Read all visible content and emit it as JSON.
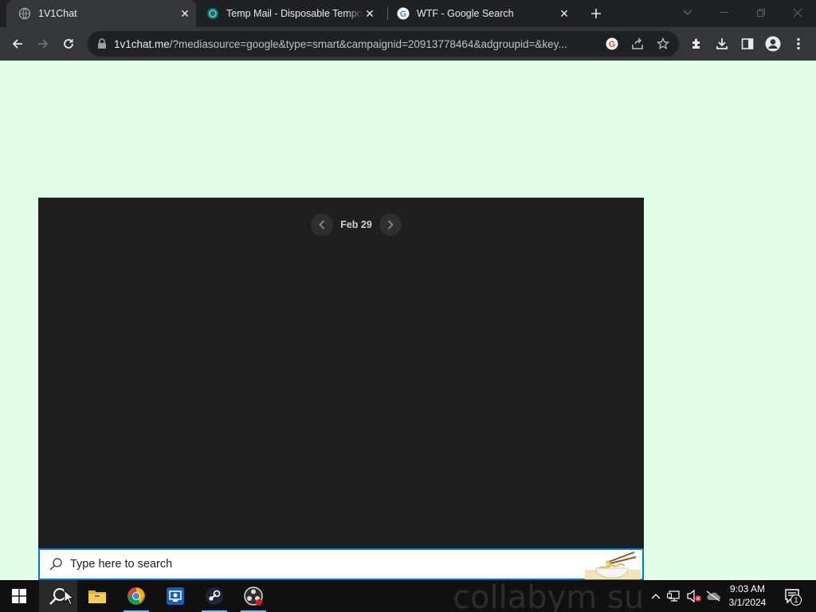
{
  "browser": {
    "tabs": [
      {
        "title": "1V1Chat",
        "favicon": "globe-icon",
        "active": true
      },
      {
        "title": "Temp Mail - Disposable Temporary Email",
        "favicon": "tempmail-icon",
        "active": false
      },
      {
        "title": "WTF - Google Search",
        "favicon": "google-icon",
        "active": false
      }
    ],
    "url_domain": "1v1chat.me",
    "url_path": "/?mediasource=google&type=smart&campaignid=20913778464&adgroupid=&key..."
  },
  "page": {
    "background": "#e1fde7",
    "video_panel": {
      "background": "#1f1f1f",
      "date_label": "Feb 29"
    }
  },
  "windows_search": {
    "placeholder": "Type here to search"
  },
  "taskbar": {
    "pinned": [
      "windows-start-icon",
      "search-icon",
      "file-explorer-icon",
      "chrome-icon",
      "remote-desktop-icon",
      "steam-icon",
      "obs-icon"
    ],
    "watermark_text": "collabym suck",
    "clock_time": "9:03 AM",
    "clock_date": "3/1/2024",
    "notification_count": "1"
  }
}
